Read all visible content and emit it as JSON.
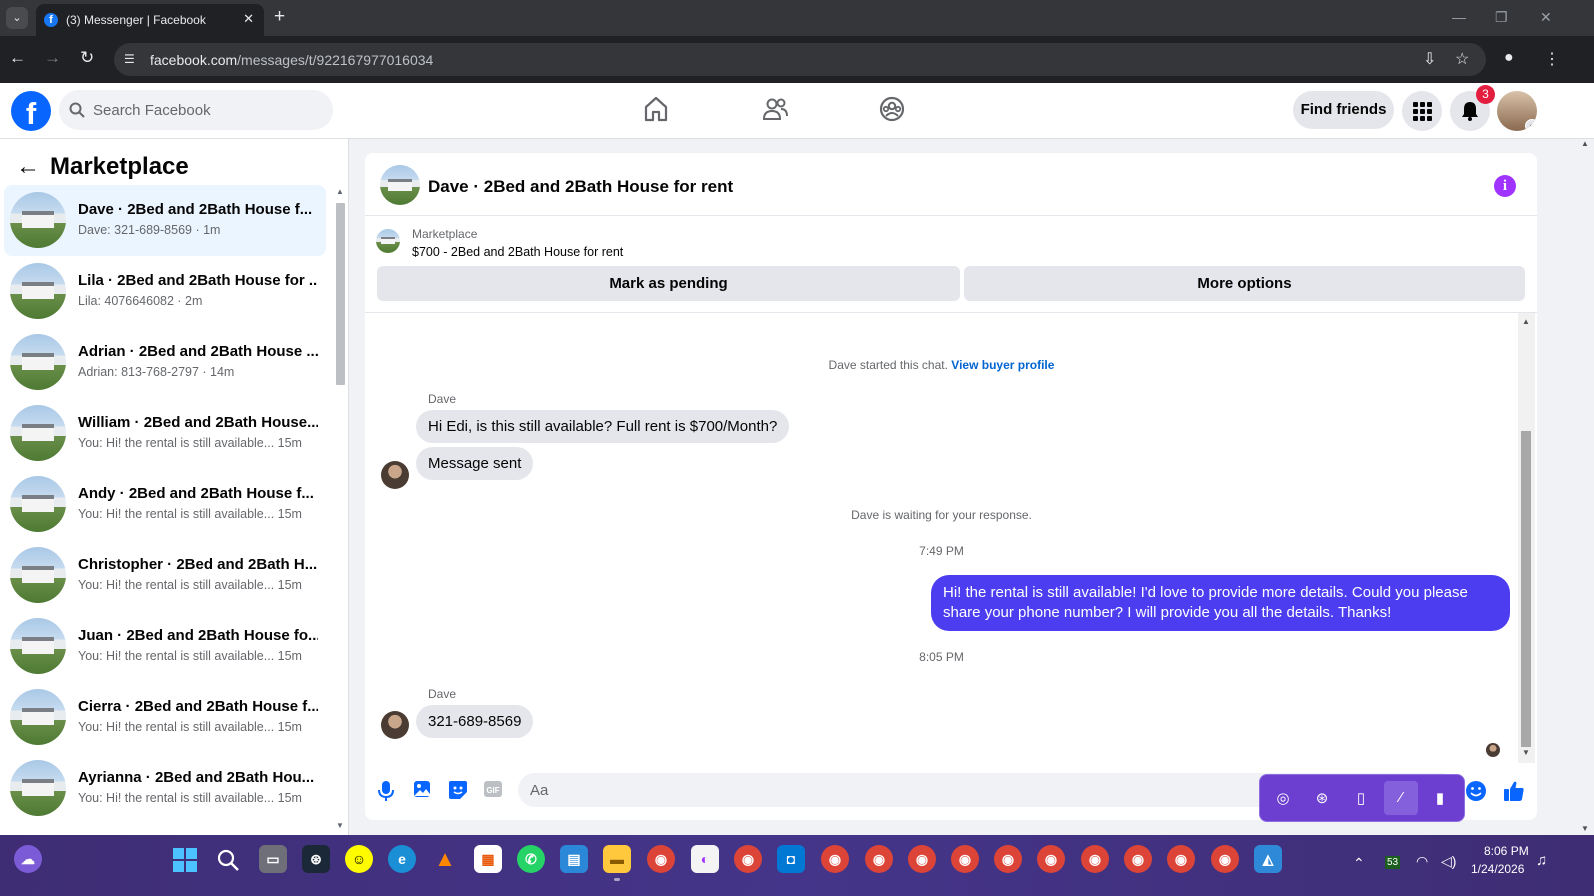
{
  "browser": {
    "tab_title": "(3) Messenger | Facebook",
    "url_domain": "facebook.com",
    "url_path": "/messages/t/922167977016034"
  },
  "header": {
    "search_placeholder": "Search Facebook",
    "find_friends": "Find friends",
    "notification_count": "3"
  },
  "sidebar": {
    "title": "Marketplace",
    "conversations": [
      {
        "name": "Dave · 2Bed and 2Bath House f...",
        "snippet": "Dave: 321-689-8569 · 1m"
      },
      {
        "name": "Lila · 2Bed and 2Bath House for ...",
        "snippet": "Lila: 4076646082 · 2m"
      },
      {
        "name": "Adrian · 2Bed and 2Bath House ...",
        "snippet": "Adrian: 813-768-2797 · 14m"
      },
      {
        "name": "William · 2Bed and 2Bath House...",
        "snippet": "You: Hi! the rental is still available... 15m"
      },
      {
        "name": "Andy · 2Bed and 2Bath House f...",
        "snippet": "You: Hi! the rental is still available... 15m"
      },
      {
        "name": "Christopher · 2Bed and 2Bath H...",
        "snippet": "You: Hi! the rental is still available... 15m"
      },
      {
        "name": "Juan · 2Bed and 2Bath House fo...",
        "snippet": "You: Hi! the rental is still available... 15m"
      },
      {
        "name": "Cierra · 2Bed and 2Bath House f...",
        "snippet": "You: Hi! the rental is still available... 15m"
      },
      {
        "name": "Ayrianna · 2Bed and 2Bath Hou...",
        "snippet": "You: Hi! the rental is still available... 15m"
      }
    ]
  },
  "chat": {
    "title": "Dave · 2Bed and 2Bath House for rent",
    "marketplace_label": "Marketplace",
    "listing": "$700 - 2Bed and 2Bath House for rent",
    "mark_pending": "Mark as pending",
    "more_options": "More options",
    "started_text": "Dave started this chat.",
    "view_profile": "View buyer profile",
    "sender": "Dave",
    "msg1": "Hi Edi, is this still available?  Full rent is $700/Month?",
    "msg2": "Message sent",
    "waiting": "Dave is waiting for your response.",
    "time1": "7:49 PM",
    "reply": "Hi! the rental is still available! I'd love to provide more details. Could you please share your phone number? I will provide you all the details. Thanks!",
    "time2": "8:05 PM",
    "msg3": "321-689-8569",
    "composer_placeholder": "Aa"
  },
  "taskbar": {
    "time": "8:06 PM",
    "date": "1/24/2026",
    "tray_badge": "53"
  }
}
